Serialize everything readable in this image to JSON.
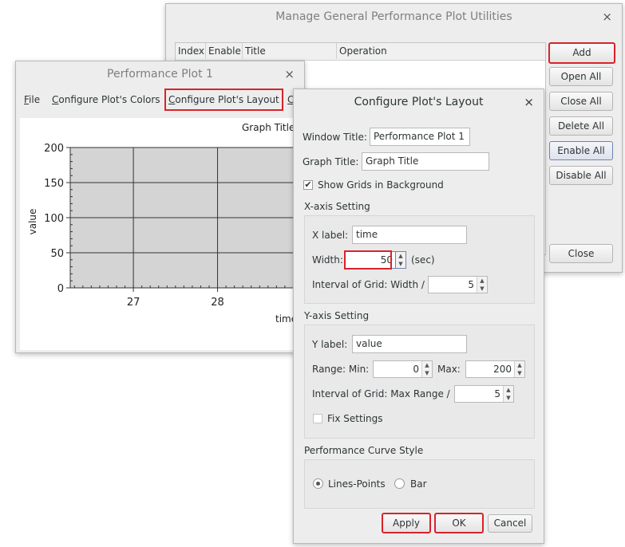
{
  "manage_window": {
    "title": "Manage General Performance Plot Utilities",
    "close": "×",
    "table_headers": [
      "Index",
      "Enable",
      "Title",
      "Operation"
    ],
    "buttons": {
      "add": "Add",
      "open_all": "Open All",
      "close_all": "Close All",
      "delete_all": "Delete All",
      "enable_all": "Enable All",
      "disable_all": "Disable All",
      "close": "Close"
    }
  },
  "plot_window": {
    "title": "Performance Plot 1",
    "close": "×",
    "menu": {
      "file": "File",
      "colors": "Configure Plot's Colors",
      "layout": "Configure Plot's Layout",
      "more": "C"
    },
    "graph_title": "Graph Title",
    "chart_data": {
      "type": "line",
      "title": "Graph Title",
      "xlabel": "time",
      "ylabel": "value",
      "x_ticks": [
        27,
        28
      ],
      "y_ticks": [
        0,
        50,
        100,
        150,
        200
      ],
      "ylim": [
        0,
        200
      ],
      "xlim": [
        26.25,
        29
      ],
      "grid": true,
      "series": []
    }
  },
  "layout_dialog": {
    "title": "Configure Plot's Layout",
    "close": "×",
    "window_title_label": "Window Title:",
    "window_title_value": "Performance Plot 1",
    "graph_title_label": "Graph Title:",
    "graph_title_value": "Graph Title",
    "show_grids_label": "Show Grids in Background",
    "show_grids_checked": "✔",
    "x_axis": {
      "section": "X-axis Setting",
      "label_label": "X label:",
      "label_value": "time",
      "width_label": "Width:",
      "width_value": "50",
      "width_unit": "(sec)",
      "grid_label": "Interval of Grid: Width /",
      "grid_value": "5"
    },
    "y_axis": {
      "section": "Y-axis Setting",
      "label_label": "Y label:",
      "label_value": "value",
      "range_label": "Range: Min:",
      "min_value": "0",
      "max_label": "Max:",
      "max_value": "200",
      "grid_label": "Interval of Grid: Max Range /",
      "grid_value": "5",
      "fix_label": "Fix Settings"
    },
    "curve": {
      "section": "Performance Curve Style",
      "lines_points": "Lines-Points",
      "bar": "Bar"
    },
    "buttons": {
      "apply": "Apply",
      "ok": "OK",
      "cancel": "Cancel"
    }
  }
}
